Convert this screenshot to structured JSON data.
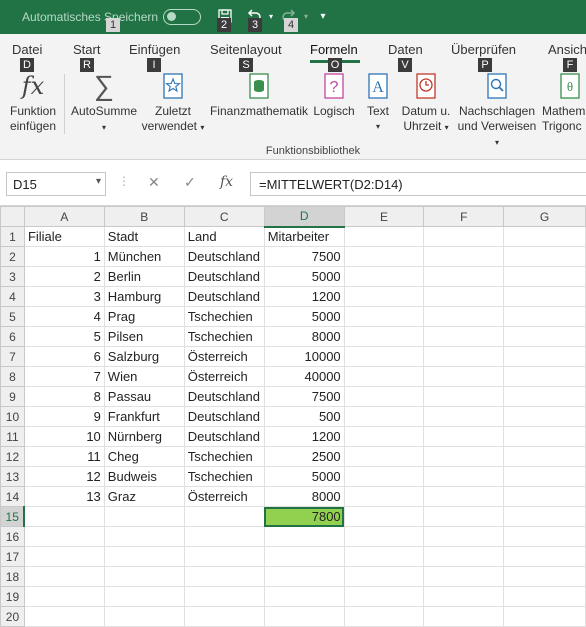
{
  "titlebar": {
    "autosave_label": "Automatisches Speichern",
    "keytips": [
      "1",
      "2",
      "3",
      "4"
    ]
  },
  "ribbon": {
    "tabs": [
      {
        "label": "Datei",
        "key": "D"
      },
      {
        "label": "Start",
        "key": "R"
      },
      {
        "label": "Einfügen",
        "key": "I"
      },
      {
        "label": "Seitenlayout",
        "key": "S"
      },
      {
        "label": "Formeln",
        "key": "O"
      },
      {
        "label": "Daten",
        "key": "V"
      },
      {
        "label": "Überprüfen",
        "key": "P"
      },
      {
        "label": "Ansicht",
        "key": "F"
      }
    ],
    "buttons": {
      "insert_function_1": "Funktion",
      "insert_function_2": "einfügen",
      "autosum": "AutoSumme",
      "recent_1": "Zuletzt",
      "recent_2": "verwendet",
      "financial": "Finanzmathematik",
      "logical": "Logisch",
      "text": "Text",
      "datetime_1": "Datum u.",
      "datetime_2": "Uhrzeit",
      "lookup_1": "Nachschlagen",
      "lookup_2": "und Verweisen",
      "math_1": "Mathem",
      "math_2": "Trigonc"
    },
    "group_label": "Funktionsbibliothek"
  },
  "formula_bar": {
    "name_box": "D15",
    "formula": "=MITTELWERT(D2:D14)"
  },
  "sheet": {
    "columns": [
      "A",
      "B",
      "C",
      "D",
      "E",
      "F",
      "G"
    ],
    "rows": [
      [
        "Filiale",
        "Stadt",
        "Land",
        "Mitarbeiter"
      ],
      [
        "1",
        "München",
        "Deutschland",
        "7500"
      ],
      [
        "2",
        "Berlin",
        "Deutschland",
        "5000"
      ],
      [
        "3",
        "Hamburg",
        "Deutschland",
        "1200"
      ],
      [
        "4",
        "Prag",
        "Tschechien",
        "5000"
      ],
      [
        "5",
        "Pilsen",
        "Tschechien",
        "8000"
      ],
      [
        "6",
        "Salzburg",
        "Österreich",
        "10000"
      ],
      [
        "7",
        "Wien",
        "Österreich",
        "40000"
      ],
      [
        "8",
        "Passau",
        "Deutschland",
        "7500"
      ],
      [
        "9",
        "Frankfurt",
        "Deutschland",
        "500"
      ],
      [
        "10",
        "Nürnberg",
        "Deutschland",
        "1200"
      ],
      [
        "11",
        "Cheg",
        "Tschechien",
        "2500"
      ],
      [
        "12",
        "Budweis",
        "Tschechien",
        "5000"
      ],
      [
        "13",
        "Graz",
        "Österreich",
        "8000"
      ],
      [
        "",
        "",
        "",
        "7800"
      ],
      [
        "",
        "",
        "",
        ""
      ],
      [
        "",
        "",
        "",
        ""
      ],
      [
        "",
        "",
        "",
        ""
      ],
      [
        "",
        "",
        "",
        ""
      ],
      [
        "",
        "",
        "",
        ""
      ]
    ],
    "row_numbers": [
      "1",
      "2",
      "3",
      "4",
      "5",
      "6",
      "7",
      "8",
      "9",
      "10",
      "11",
      "12",
      "13",
      "14",
      "15",
      "16",
      "17",
      "18",
      "19",
      "20"
    ],
    "active_row": 15,
    "active_col": "D"
  },
  "colors": {
    "excel_green": "#217346",
    "active_fill": "#92d050"
  }
}
